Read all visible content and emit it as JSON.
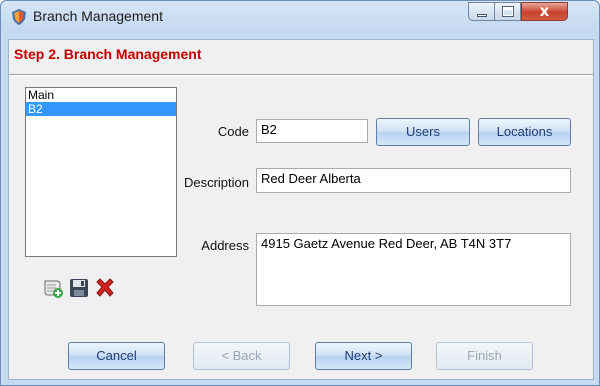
{
  "window": {
    "title": "Branch Management",
    "close_glyph": "x"
  },
  "step": {
    "title": "Step 2. Branch Management"
  },
  "branches": [
    {
      "label": "Main",
      "selected": false
    },
    {
      "label": "B2",
      "selected": true
    }
  ],
  "actions": {
    "icons": [
      "add-branch-icon",
      "save-icon",
      "delete-icon"
    ]
  },
  "form": {
    "code_label": "Code",
    "code_value": "B2",
    "users_button": "Users",
    "locations_button": "Locations",
    "description_label": "Description",
    "description_value": "Red Deer Alberta",
    "address_label": "Address",
    "address_value": "4915 Gaetz Avenue Red Deer, AB T4N 3T7"
  },
  "footer": {
    "cancel": "Cancel",
    "back": "< Back",
    "next": "Next >",
    "finish": "Finish"
  },
  "colors": {
    "accent_red": "#c00000",
    "selection": "#3399ff"
  }
}
